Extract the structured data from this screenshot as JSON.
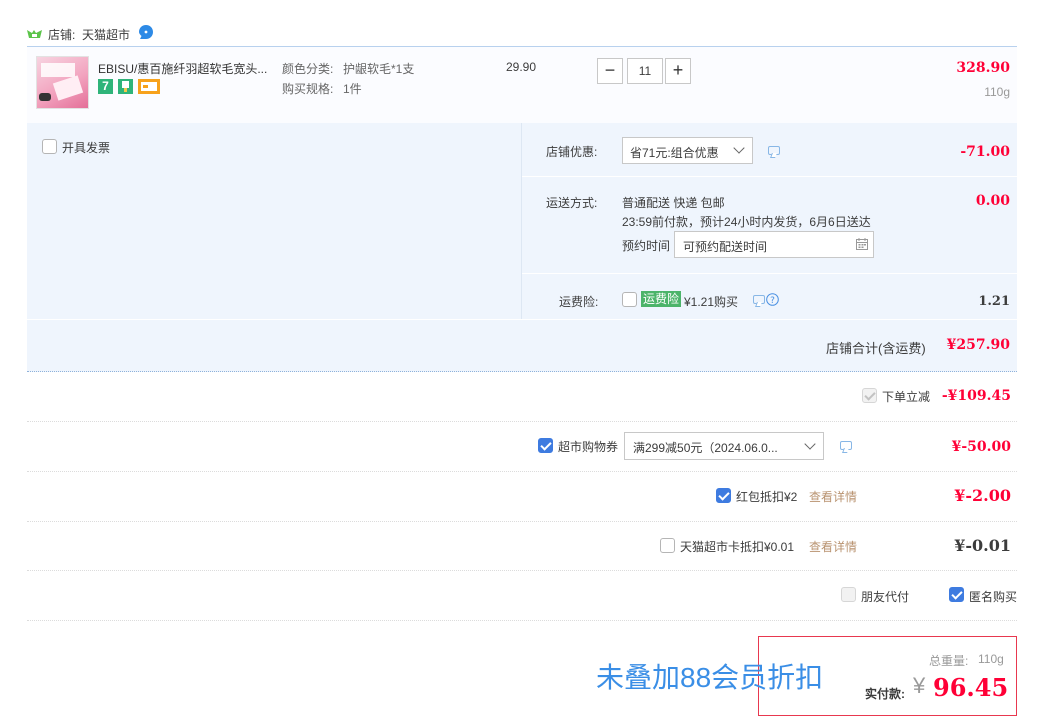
{
  "store": {
    "label": "店铺:",
    "name": "天猫超市"
  },
  "item": {
    "title": "EBISU/惠百施纤羽超软毛宽头...",
    "color_label": "颜色分类:",
    "color_value": "护龈软毛*1支",
    "spec_label": "购买规格:",
    "spec_value": "1件",
    "unit_price": "29.90",
    "quantity": "11",
    "qty_minus": "−",
    "qty_plus": "+",
    "subtotal": "328.90",
    "weight": "110g",
    "badge_seven": "7"
  },
  "invoice": {
    "label": "开具发票"
  },
  "discount": {
    "label": "店铺优惠:",
    "select": "省71元:组合优惠",
    "amount": "-71.00"
  },
  "shipping": {
    "label": "运送方式:",
    "method": "普通配送 快递 包邮",
    "eta": "23:59前付款，预计24小时内发货，6月6日送达",
    "appt_label": "预约时间",
    "appt_placeholder": "可预约配送时间",
    "amount": "0.00"
  },
  "insurance": {
    "label": "运费险:",
    "tag": "运费险",
    "price": "¥1.21购买",
    "amount": "1.21"
  },
  "store_total": {
    "label": "店铺合计(含运费)",
    "amount": "¥257.90"
  },
  "instant_discount": {
    "label": "下单立减",
    "amount": "-¥109.45"
  },
  "coupon": {
    "label": "超市购物券",
    "select": "满299减50元（2024.06.0...",
    "amount": "¥-50.00"
  },
  "red_packet": {
    "label": "红包抵扣¥2",
    "link": "查看详情",
    "amount": "¥-2.00"
  },
  "card": {
    "label": "天猫超市卡抵扣¥0.01",
    "link": "查看详情",
    "amount": "¥-0.01"
  },
  "friend_pay": {
    "label": "朋友代付"
  },
  "anonymous": {
    "label": "匿名购买"
  },
  "summary": {
    "weight_label": "总重量:",
    "weight": "110g",
    "pay_label": "实付款:",
    "currency": "¥",
    "amount": "96.45"
  },
  "annotation": "未叠加88会员折扣",
  "colors": {
    "price_red": "#ff0036",
    "link_brown": "#b99370",
    "panel_bg": "#eff5fd",
    "border_blue": "#b8d1ee",
    "annotation_blue": "#3a8ee6",
    "highlight_red": "#e8384f"
  }
}
